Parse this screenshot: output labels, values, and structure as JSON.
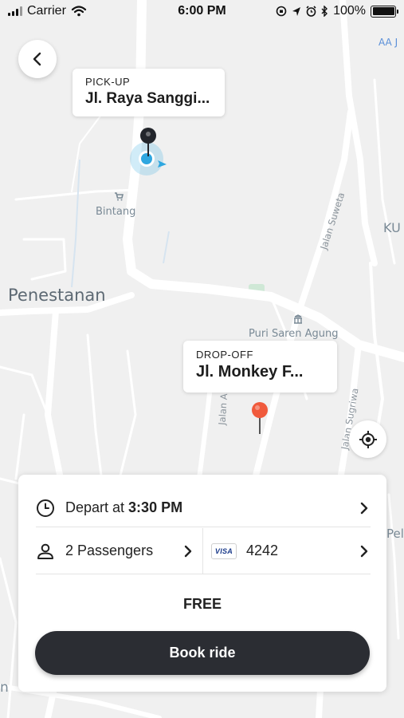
{
  "status_bar": {
    "carrier": "Carrier",
    "time": "6:00 PM",
    "battery": "100%"
  },
  "map": {
    "labels": {
      "penestanan": "Penestanan",
      "bintang": "Bintang",
      "puri_saren": "Puri Saren Agung",
      "jalan_suweta": "Jalan Suweta",
      "jalan_sugriwa": "Jalan Sugriwa",
      "jalan_a": "Jalan A",
      "ku": "KU",
      "aaj": "AA J",
      "pel": "Pel",
      "n": "n"
    }
  },
  "pickup": {
    "label": "PICK-UP",
    "value": "Jl. Raya Sanggi..."
  },
  "dropoff": {
    "label": "DROP-OFF",
    "value": "Jl. Monkey F..."
  },
  "booking": {
    "depart_prefix": "Depart at ",
    "depart_time": "3:30 PM",
    "passengers": "2 Passengers",
    "card_brand": "VISA",
    "card_last4": "4242",
    "price": "FREE",
    "book_label": "Book ride"
  },
  "icons": {
    "back": "chevron-left-icon",
    "locate": "crosshair-icon",
    "clock": "clock-icon",
    "person": "person-icon",
    "chevron": "chevron-right-icon"
  },
  "colors": {
    "button_bg": "#2b2d33",
    "dropoff_pin": "#f05a3c",
    "current_location": "#2fa7e0",
    "pickup_pin": "#22252b"
  }
}
